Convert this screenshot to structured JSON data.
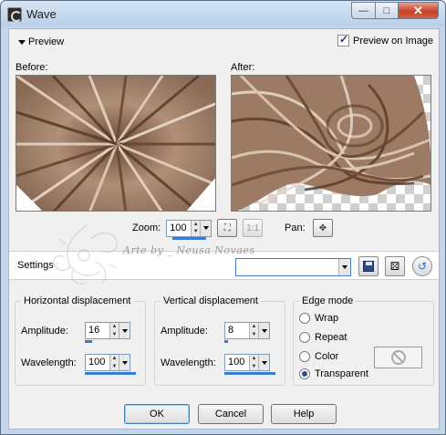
{
  "window": {
    "title": "Wave"
  },
  "titlebar": {
    "minimize": "—",
    "maximize": "□",
    "close": "✕"
  },
  "preview": {
    "toggle_label": "Preview",
    "preview_on_image_label": "Preview on Image",
    "preview_on_image_checked": true,
    "before_label": "Before:",
    "after_label": "After:"
  },
  "zoom": {
    "label": "Zoom:",
    "value": "100",
    "pan_label": "Pan:"
  },
  "settings": {
    "label": "Settings",
    "value": ""
  },
  "horizontal": {
    "title": "Horizontal displacement",
    "amplitude_label": "Amplitude:",
    "amplitude": "16",
    "wavelength_label": "Wavelength:",
    "wavelength": "100"
  },
  "vertical": {
    "title": "Vertical displacement",
    "amplitude_label": "Amplitude:",
    "amplitude": "8",
    "wavelength_label": "Wavelength:",
    "wavelength": "100"
  },
  "edge_mode": {
    "title": "Edge mode",
    "options": [
      "Wrap",
      "Repeat",
      "Color",
      "Transparent"
    ],
    "selected": "Transparent"
  },
  "buttons": {
    "ok": "OK",
    "cancel": "Cancel",
    "help": "Help"
  },
  "watermark": {
    "text": "Arte by _ Neusa Novaes"
  },
  "colors": {
    "accent": "#3a7bd5",
    "image_brown": "#9c7a63",
    "titlebar": "#c4d6ea"
  }
}
